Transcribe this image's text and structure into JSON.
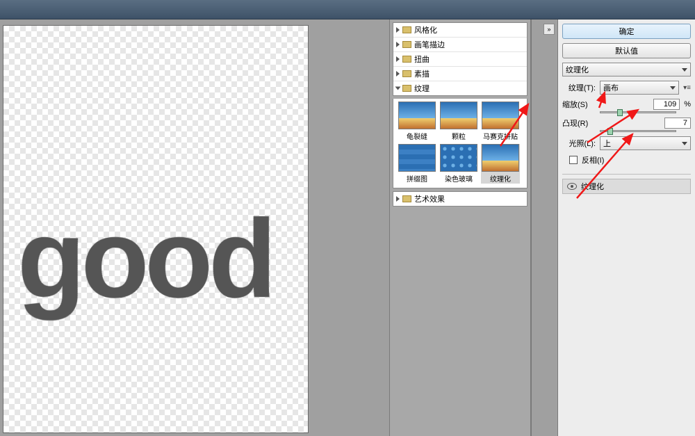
{
  "buttons": {
    "ok": "确定",
    "default": "默认值"
  },
  "filter_combo": {
    "value": "纹理化"
  },
  "categories": [
    {
      "label": "风格化",
      "open": false
    },
    {
      "label": "画笔描边",
      "open": false
    },
    {
      "label": "扭曲",
      "open": false
    },
    {
      "label": "素描",
      "open": false
    },
    {
      "label": "纹理",
      "open": true
    },
    {
      "label": "艺术效果",
      "open": false
    }
  ],
  "thumbnails": [
    {
      "label": "龟裂缝",
      "sel": false
    },
    {
      "label": "颗粒",
      "sel": false
    },
    {
      "label": "马赛克拼贴",
      "sel": false
    },
    {
      "label": "拼缀图",
      "sel": false
    },
    {
      "label": "染色玻璃",
      "sel": false
    },
    {
      "label": "纹理化",
      "sel": true
    }
  ],
  "settings": {
    "texture_label": "纹理(T):",
    "texture_value": "画布",
    "scale_label": "缩放(S)",
    "scale_value": "109",
    "scale_unit": "%",
    "relief_label": "凸现(R)",
    "relief_value": "7",
    "light_label": "光照(L):",
    "light_value": "上",
    "invert_label": "反相(I)"
  },
  "lower_panel": {
    "title": "纹理化"
  },
  "canvas_text": "good"
}
